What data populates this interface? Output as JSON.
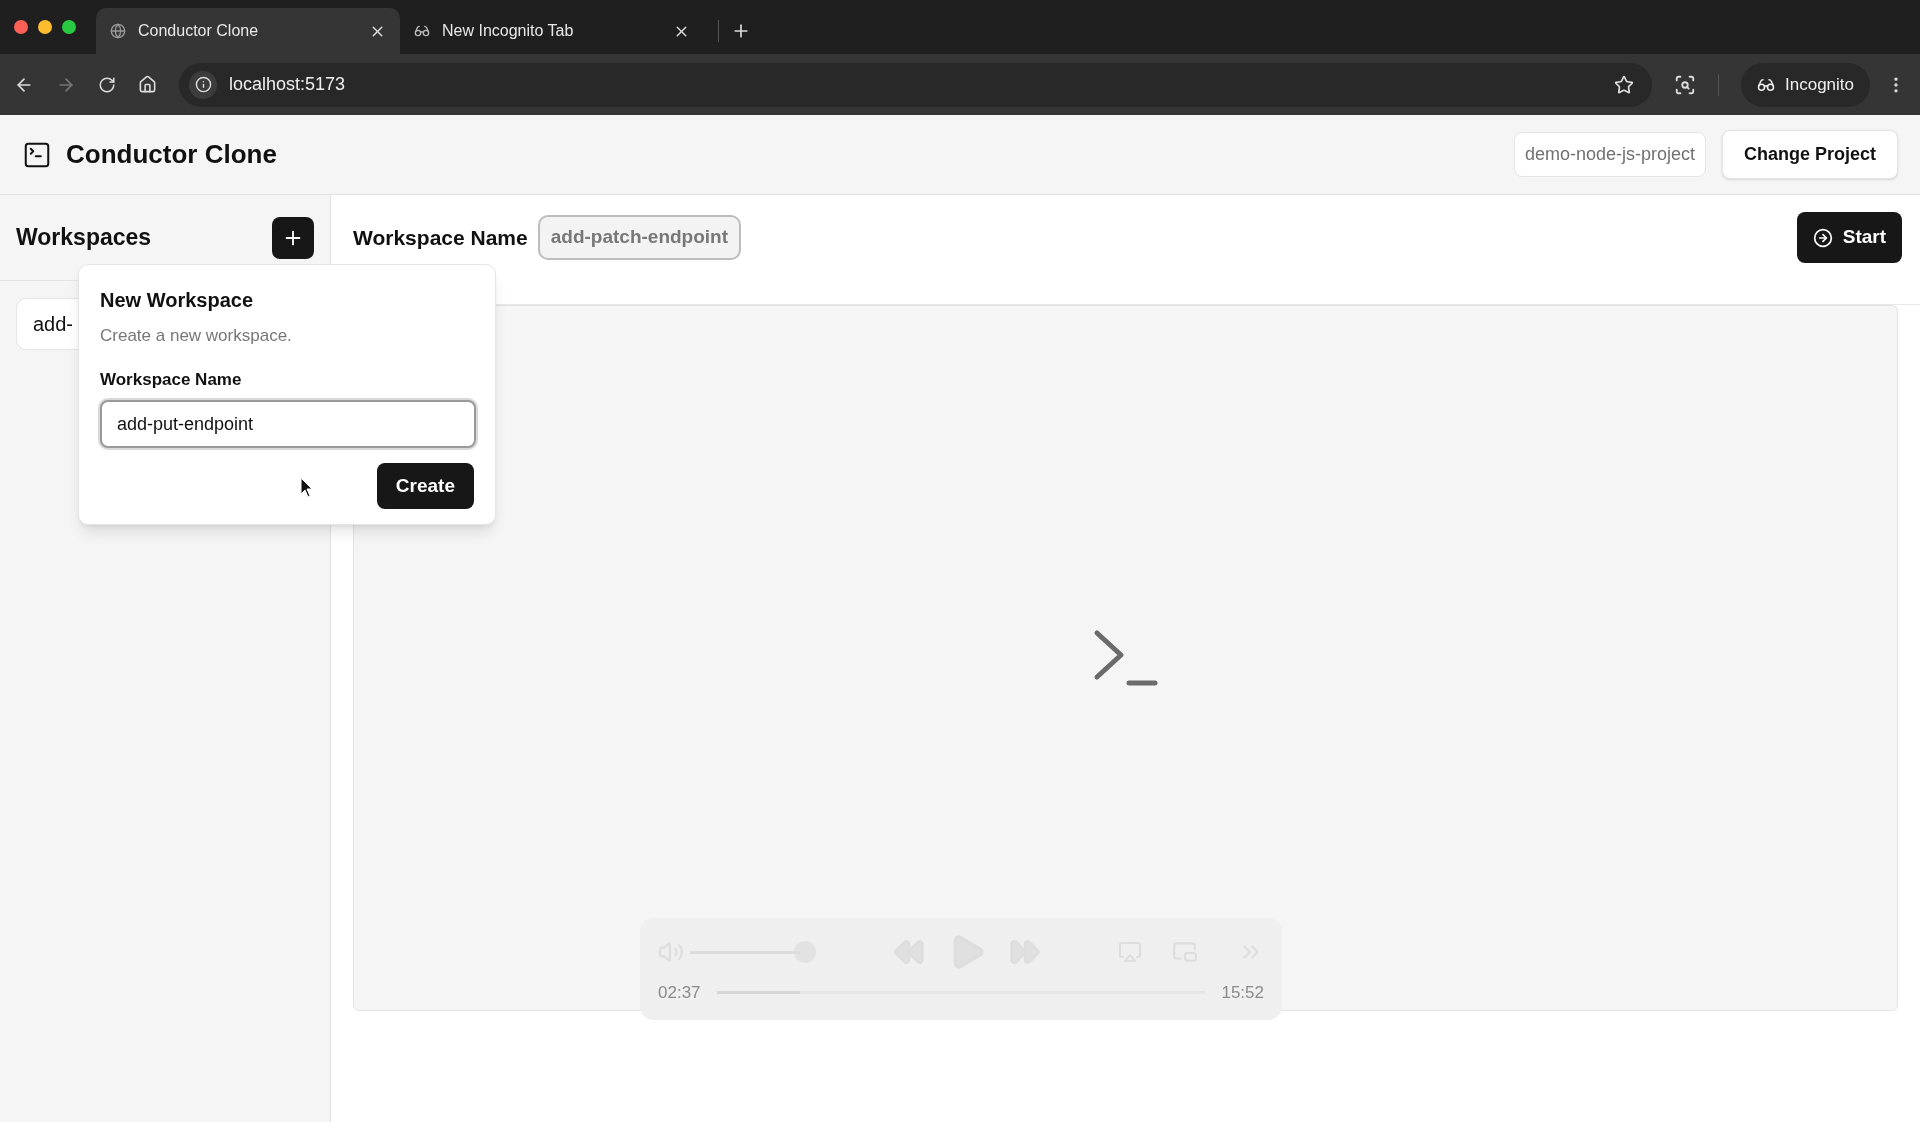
{
  "browser": {
    "tabs": [
      {
        "title": "Conductor Clone",
        "selected": true
      },
      {
        "title": "New Incognito Tab",
        "selected": false
      }
    ],
    "address": "localhost:5173",
    "profile": "Incognito"
  },
  "app": {
    "title": "Conductor Clone",
    "project": "demo-node-js-project",
    "change_button": "Change Project"
  },
  "sidebar": {
    "title": "Workspaces",
    "items": [
      {
        "label": "add-"
      }
    ]
  },
  "workspace": {
    "label": "Workspace Name",
    "name": "add-patch-endpoint",
    "start_button": "Start"
  },
  "popover": {
    "title": "New Workspace",
    "description": "Create a new workspace.",
    "field_label": "Workspace Name",
    "field_value": "add-put-endpoint",
    "button": "Create"
  },
  "media_controls": {
    "elapsed": "02:37",
    "duration": "15:52",
    "volume": {
      "level": 1
    },
    "progress": {
      "level": 0.17
    }
  }
}
